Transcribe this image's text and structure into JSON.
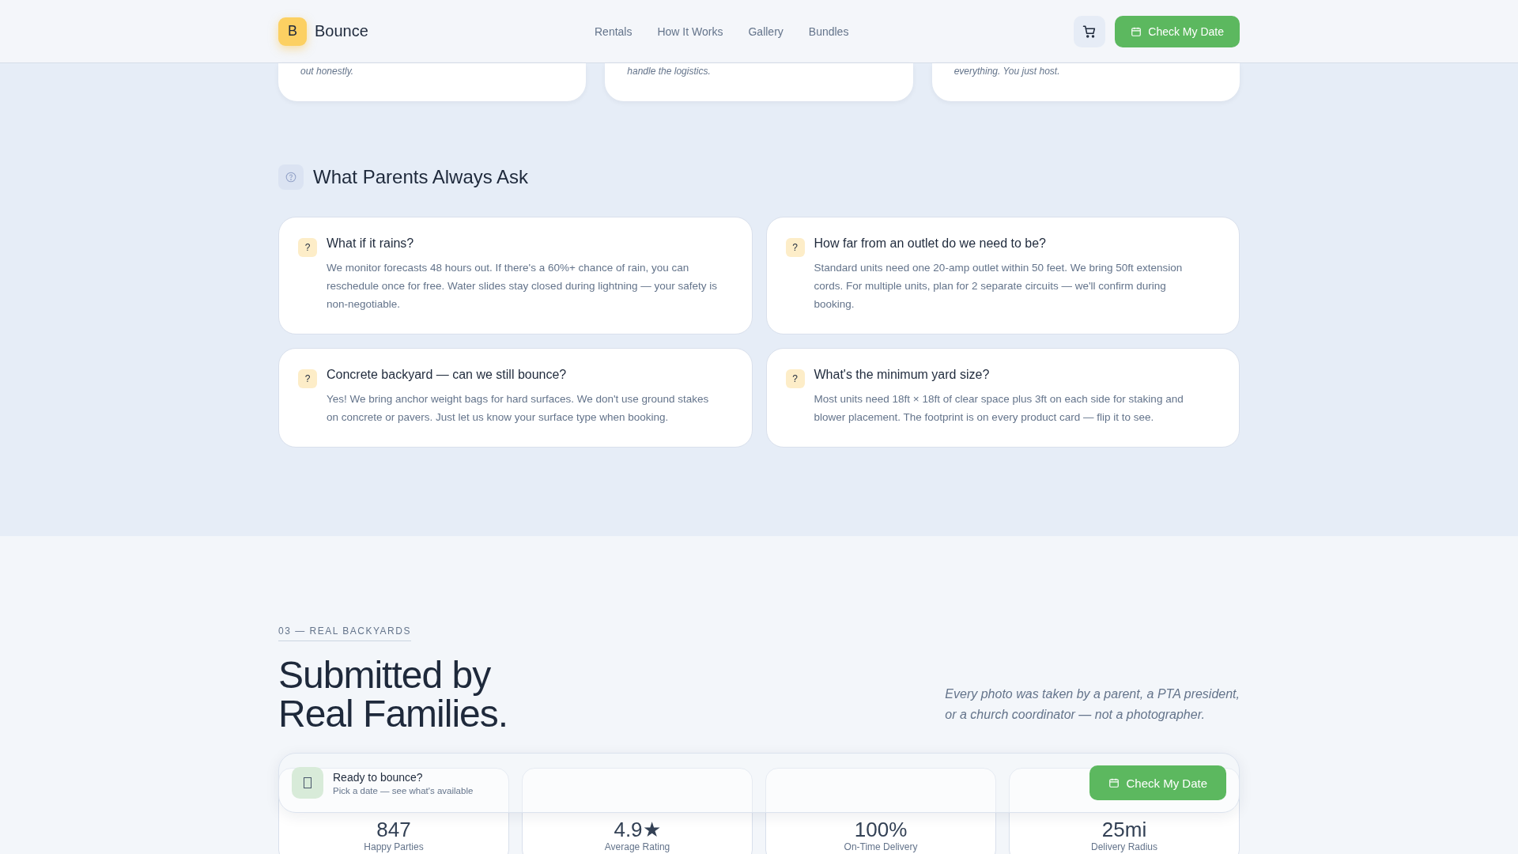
{
  "header": {
    "logo_letter": "B",
    "brand": "Bounce",
    "nav": [
      {
        "label": "Rentals"
      },
      {
        "label": "How It Works"
      },
      {
        "label": "Gallery"
      },
      {
        "label": "Bundles"
      }
    ],
    "cta": "Check My Date"
  },
  "feature_cards": [
    {
      "text": "out honestly."
    },
    {
      "text": "handle the logistics."
    },
    {
      "text": "everything. You just host."
    }
  ],
  "faq": {
    "title": "What Parents Always Ask",
    "items": [
      {
        "mark": "?",
        "question": "What if it rains?",
        "answer": "We monitor forecasts 48 hours out. If there's a 60%+ chance of rain, you can reschedule once for free. Water slides stay closed during lightning — your safety is non-negotiable."
      },
      {
        "mark": "?",
        "question": "How far from an outlet do we need to be?",
        "answer": "Standard units need one 20-amp outlet within 50 feet. We bring 50ft extension cords. For multiple units, plan for 2 separate circuits — we'll confirm during booking."
      },
      {
        "mark": "?",
        "question": "Concrete backyard — can we still bounce?",
        "answer": "Yes! We bring anchor weight bags for hard surfaces. We don't use ground stakes on concrete or pavers. Just let us know your surface type when booking."
      },
      {
        "mark": "?",
        "question": "What's the minimum yard size?",
        "answer": "Most units need 18ft × 18ft of clear space plus 3ft on each side for staking and blower placement. The footprint is on every product card — flip it to see."
      }
    ]
  },
  "gallery": {
    "eyebrow": "03 — REAL BACKYARDS",
    "title_lines": [
      "Submitted by",
      "Real Families."
    ],
    "note_lines": [
      "Every photo was taken by a parent, a PTA president,",
      "or a church coordinator — not a photographer."
    ]
  },
  "stats": [
    {
      "value": "847",
      "label": "Happy Parties"
    },
    {
      "value": "4.9★",
      "label": "Average Rating"
    },
    {
      "value": "100%",
      "label": "On-Time Delivery"
    },
    {
      "value": "25mi",
      "label": "Delivery Radius"
    }
  ],
  "booking_bar": {
    "title": "Ready to bounce?",
    "subtitle": "Pick a date — see what's available",
    "cta": "Check My Date"
  }
}
